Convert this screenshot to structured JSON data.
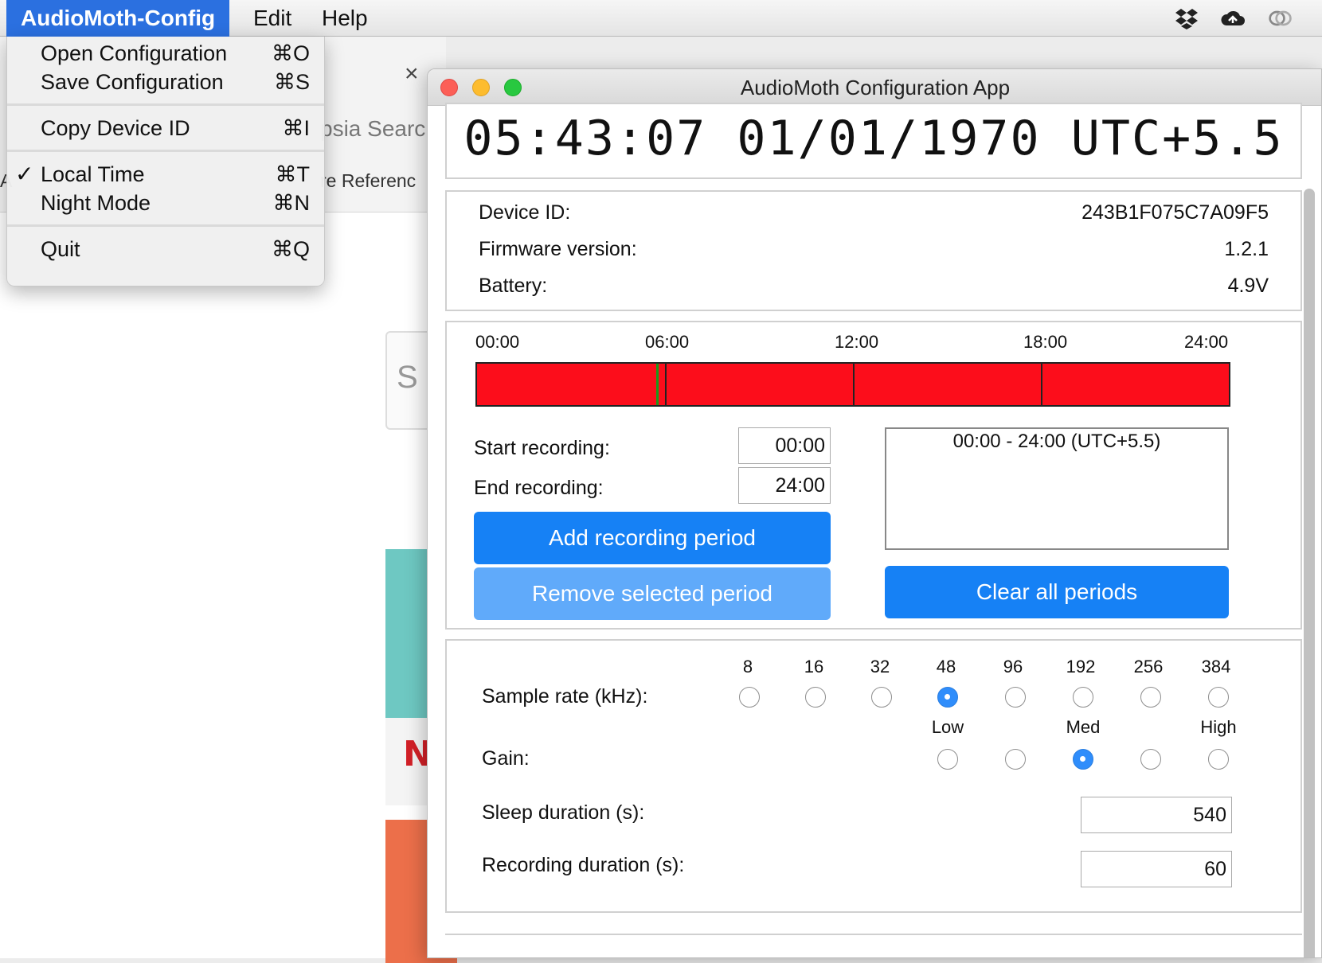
{
  "menubar": {
    "app_name": "AudioMoth-Config",
    "edit": "Edit",
    "help": "Help",
    "tray_icons": [
      "dropbox-icon",
      "creative-cloud-icon",
      "sync-icon"
    ]
  },
  "app_menu": {
    "items": [
      {
        "label": "Open Configuration",
        "shortcut": "⌘O"
      },
      {
        "label": "Save Configuration",
        "shortcut": "⌘S"
      },
      {
        "label": "Copy Device ID",
        "shortcut": "⌘I"
      },
      {
        "label": "Local Time",
        "shortcut": "⌘T",
        "checked": true
      },
      {
        "label": "Night Mode",
        "shortcut": "⌘N"
      },
      {
        "label": "Quit",
        "shortcut": "⌘Q"
      }
    ]
  },
  "background_browser": {
    "tab_close": "×",
    "search_fragment": "psia Searc",
    "reference_fragment": "re Referenc",
    "left_edge_fragment": "A",
    "search_box_letter": "S",
    "card_letter": "N"
  },
  "window": {
    "title": "AudioMoth Configuration App"
  },
  "clock": {
    "time": "05:43:07",
    "date": "01/01/1970",
    "timezone": "UTC+5.5",
    "display": "05:43:07 01/01/1970 UTC+5.5"
  },
  "device": {
    "id_label": "Device ID:",
    "id_value": "243B1F075C7A09F5",
    "firmware_label": "Firmware version:",
    "firmware_value": "1.2.1",
    "battery_label": "Battery:",
    "battery_value": "4.9V"
  },
  "schedule": {
    "ticks": [
      "00:00",
      "06:00",
      "12:00",
      "18:00",
      "24:00"
    ],
    "current_time_fraction": 0.2383,
    "start_label": "Start recording:",
    "start_value": "00:00",
    "end_label": "End recording:",
    "end_value": "24:00",
    "add_button": "Add recording period",
    "remove_button": "Remove selected period",
    "clear_button": "Clear all periods",
    "periods": [
      "00:00 - 24:00 (UTC+5.5)"
    ],
    "colors": {
      "recording": "#fc0d1b",
      "marker": "#1a9a1a"
    }
  },
  "settings": {
    "sample_rate_label": "Sample rate (kHz):",
    "sample_rates": [
      "8",
      "16",
      "32",
      "48",
      "96",
      "192",
      "256",
      "384"
    ],
    "selected_sample_rate": "48",
    "gain_label": "Gain:",
    "gain_labels": [
      "Low",
      "Med",
      "High"
    ],
    "gain_options": 5,
    "selected_gain_index": 2,
    "sleep_label": "Sleep duration (s):",
    "sleep_value": "540",
    "recording_label": "Recording duration (s):",
    "recording_value": "60"
  }
}
